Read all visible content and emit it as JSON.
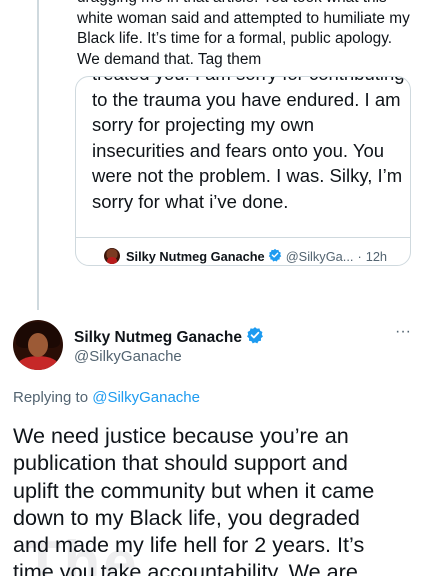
{
  "parent_tweet": {
    "text_lines": [
      "dragging me in that article. You took what this",
      "white woman said and attempted to humiliate my",
      "Black life. It’s time for a formal, public apology.",
      "We demand that. Tag them"
    ]
  },
  "quoted_tweet": {
    "text_lines": [
      "treated you. I am sorry for contributing",
      "to the trauma you have endured. I am",
      "sorry for projecting my own",
      "insecurities and fears onto you. You",
      "were not the problem. I was. Silky, I’m",
      "sorry for what i’ve done."
    ],
    "author_name": "Silky Nutmeg Ganache",
    "author_handle": "@SilkyGa...",
    "separator": "·",
    "timestamp": "12h"
  },
  "reply_tweet": {
    "author_name": "Silky Nutmeg Ganache",
    "author_handle": "@SilkyGanache",
    "more_label": "···",
    "replying_prefix": "Replying to",
    "replying_mention": "@SilkyGanache",
    "text_lines": [
      "We need justice because you’re an",
      "publication that should support and",
      "uplift the community but when it came",
      "down to my Black life, you degraded",
      "and made my life hell for 2 years. It’s",
      "time you take accountability. We are"
    ]
  },
  "watermark_text": "The",
  "colors": {
    "verified_badge": "#1d9bf0",
    "link": "#1d9bf0",
    "secondary_text": "#536471",
    "border": "#cfd9de"
  },
  "icons": {
    "verified": "verified-badge-icon",
    "more": "more-options-icon"
  }
}
